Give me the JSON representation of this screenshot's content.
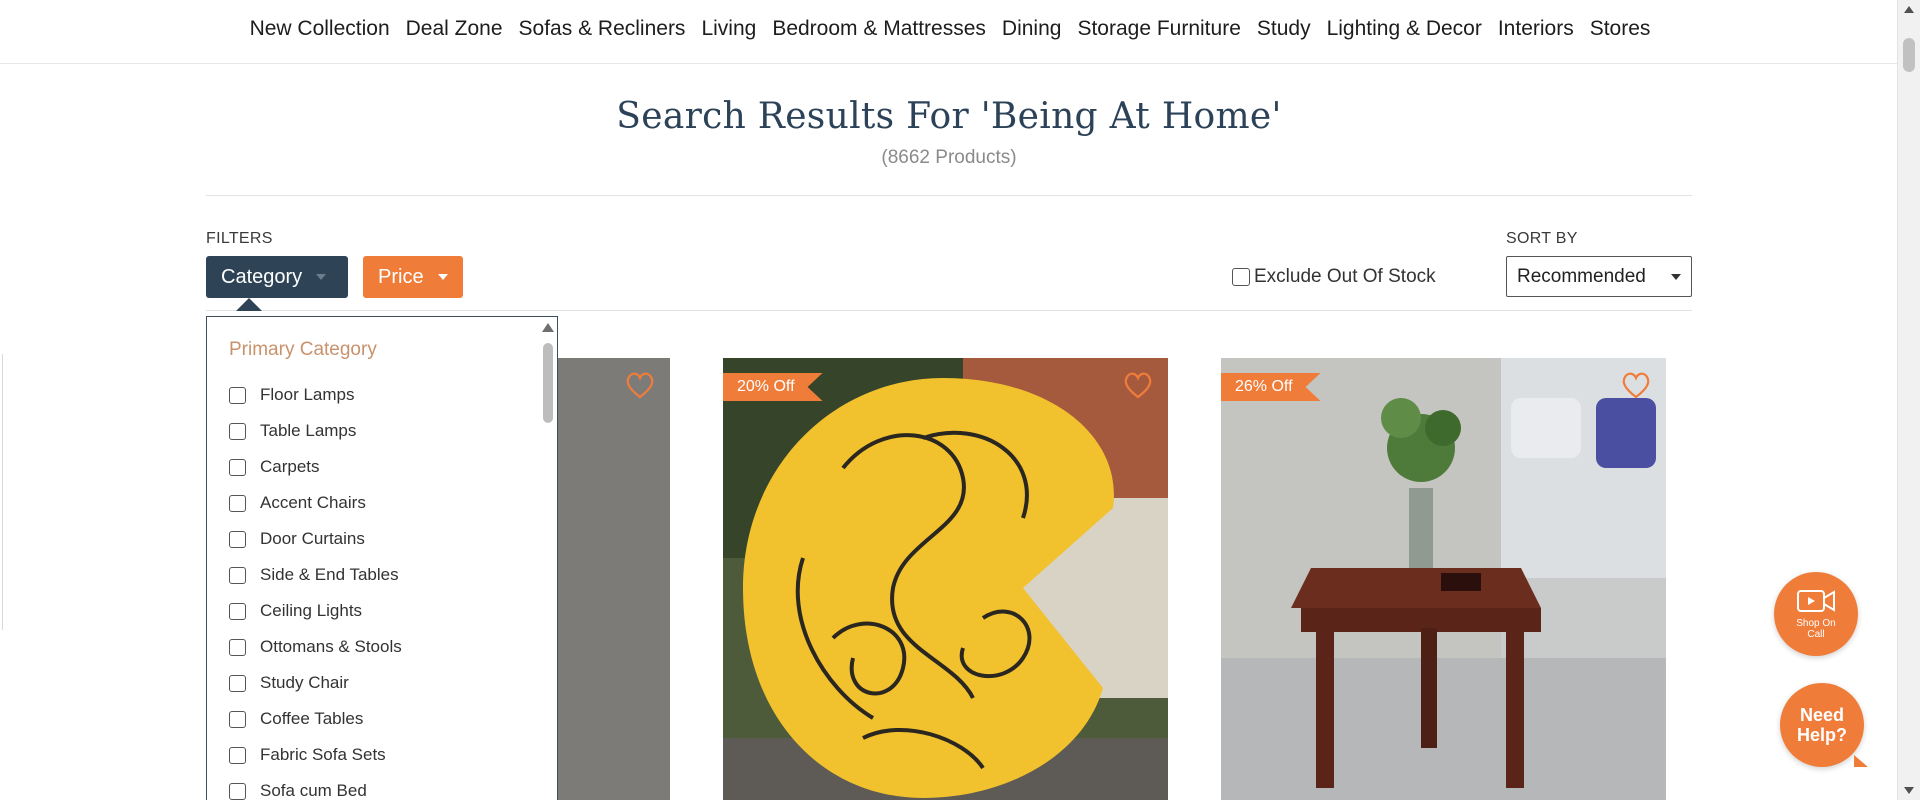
{
  "nav": {
    "items": [
      "New Collection",
      "Deal Zone",
      "Sofas & Recliners",
      "Living",
      "Bedroom & Mattresses",
      "Dining",
      "Storage Furniture",
      "Study",
      "Lighting & Decor",
      "Interiors",
      "Stores"
    ]
  },
  "results": {
    "title": "Search Results For 'Being At Home'",
    "count": "(8662 Products)"
  },
  "filters": {
    "label": "FILTERS",
    "category_label": "Category",
    "price_label": "Price",
    "exclude_label": "Exclude Out Of Stock",
    "exclude_checked": false
  },
  "sort": {
    "label": "SORT BY",
    "selected": "Recommended"
  },
  "category_panel": {
    "heading": "Primary Category",
    "items": [
      "Floor Lamps",
      "Table Lamps",
      "Carpets",
      "Accent Chairs",
      "Door Curtains",
      "Side & End Tables",
      "Ceiling Lights",
      "Ottomans & Stools",
      "Study Chair",
      "Coffee Tables",
      "Fabric Sofa Sets",
      "Sofa cum Bed"
    ]
  },
  "products": [
    {
      "badge": "",
      "image": "living-room-decor-image"
    },
    {
      "badge": "20% Off",
      "image": "yellow-abstract-rug-image"
    },
    {
      "badge": "26% Off",
      "image": "wooden-side-table-image"
    }
  ],
  "floating": {
    "shop_on_call": "Shop On Call",
    "need_help": "Need Help?"
  },
  "colors": {
    "brand_orange": "#f07c3a",
    "navy": "#2e4456",
    "title_blue": "#2c4258",
    "category_heading": "#c9926c"
  }
}
